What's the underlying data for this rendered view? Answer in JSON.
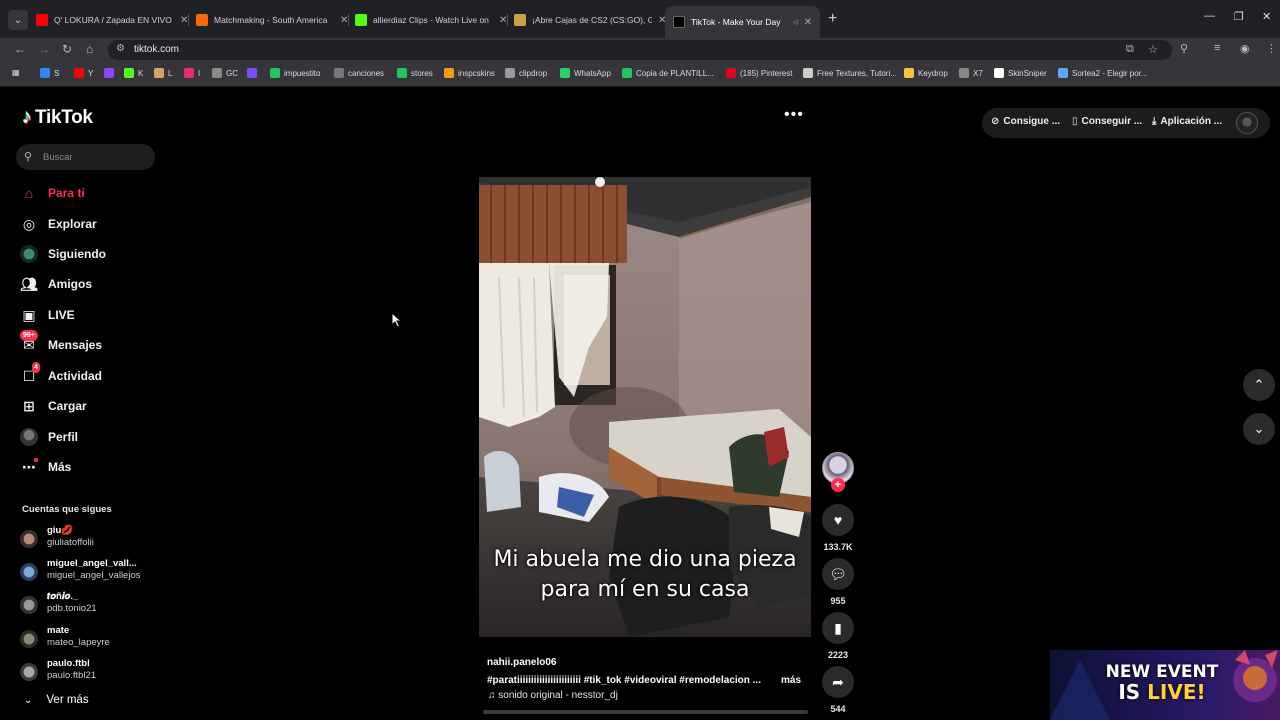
{
  "browser": {
    "tabs": [
      {
        "title": "Q' LOKURA / Zapada EN VIVO c",
        "favicon_color": "#ff0000"
      },
      {
        "title": "Matchmaking - South America",
        "favicon_color": "#ff6a00"
      },
      {
        "title": "allierdiaz Clips - Watch Live on",
        "favicon_color": "#53fc18"
      },
      {
        "title": "¡Abre Cajas de CS2 (CS:GO), Ga",
        "favicon_color": "#c9a24a"
      },
      {
        "title": "TikTok - Make Your Day",
        "favicon_color": "#000000",
        "active": true
      }
    ],
    "url": "tiktok.com",
    "bookmarks": [
      {
        "label": "S",
        "color": "#3b82f6"
      },
      {
        "label": "Y",
        "color": "#ff0000"
      },
      {
        "label": "",
        "color": "#9146ff"
      },
      {
        "label": "K",
        "color": "#53fc18"
      },
      {
        "label": "L",
        "color": "#d9a15c"
      },
      {
        "label": "I",
        "color": "#e1306c"
      },
      {
        "label": "GC",
        "color": "#8a8a8a"
      },
      {
        "label": "",
        "color": "#7c4dff"
      },
      {
        "label": "impuestito",
        "color": "#22c55e"
      },
      {
        "label": "canciones",
        "color": "#777777"
      },
      {
        "label": "stores",
        "color": "#22c55e"
      },
      {
        "label": "inspcskins",
        "color": "#f59e0b"
      },
      {
        "label": "clipdrop",
        "color": "#999999"
      },
      {
        "label": "WhatsApp",
        "color": "#25d366"
      },
      {
        "label": "Copia de PLANTILL...",
        "color": "#22c55e"
      },
      {
        "label": "(185) Pinterest",
        "color": "#e60023"
      },
      {
        "label": "Free Textures, Tutori...",
        "color": "#cccccc"
      },
      {
        "label": "Keydrop",
        "color": "#f5c542"
      },
      {
        "label": "X7",
        "color": "#8a8a8a"
      },
      {
        "label": "SkinSniper",
        "color": "#ffffff"
      },
      {
        "label": "Sortea2 - Elegir por...",
        "color": "#60a5fa"
      }
    ]
  },
  "tiktok": {
    "logo": "TikTok",
    "search_placeholder": "Buscar",
    "nav": [
      {
        "label": "Para ti",
        "icon": "home-icon",
        "active": true
      },
      {
        "label": "Explorar",
        "icon": "compass-icon"
      },
      {
        "label": "Siguiendo",
        "icon": "following-avatar-icon"
      },
      {
        "label": "Amigos",
        "icon": "friends-icon"
      },
      {
        "label": "LIVE",
        "icon": "live-tv-icon"
      },
      {
        "label": "Mensajes",
        "icon": "messages-icon",
        "badge": "99+"
      },
      {
        "label": "Actividad",
        "icon": "activity-icon",
        "badge": "4"
      },
      {
        "label": "Cargar",
        "icon": "upload-plus-icon"
      },
      {
        "label": "Perfil",
        "icon": "profile-avatar-icon"
      },
      {
        "label": "Más",
        "icon": "more-dots-icon"
      }
    ],
    "following_heading": "Cuentas que sigues",
    "following": [
      {
        "name": "giu💋",
        "handle": "giuliatoffolii"
      },
      {
        "name": "miguel_angel_vall...",
        "handle": "miguel_angel_vallejos"
      },
      {
        "name": "𝒕𝒐ñ𝒊𝒐._",
        "handle": "pdb.tonio21"
      },
      {
        "name": "mate",
        "handle": "mateo_lapeyre"
      },
      {
        "name": "paulo.ftbl",
        "handle": "paulo.ftbl21"
      }
    ],
    "see_more": "Ver más",
    "top_buttons": [
      "Consigue ...",
      "Conseguir ...",
      "Aplicación ..."
    ],
    "video": {
      "caption_line1": "Mi abuela me dio una pieza",
      "caption_line2": "para mí en su casa",
      "creator": "nahii.panelo06",
      "hashtags": "#paratiiiiiiiiiiiiiiiiiiiiiii  #tik_tok  #videoviral  #remodelacion   ...",
      "more": "más",
      "sound": "♫ sonido original - nesstor_dj",
      "likes": "133.7K",
      "comments": "955",
      "saves": "2223",
      "shares": "544"
    },
    "event_banner": {
      "line1": "NEW EVENT",
      "line2_a": "IS ",
      "line2_b": "LIVE!"
    }
  }
}
